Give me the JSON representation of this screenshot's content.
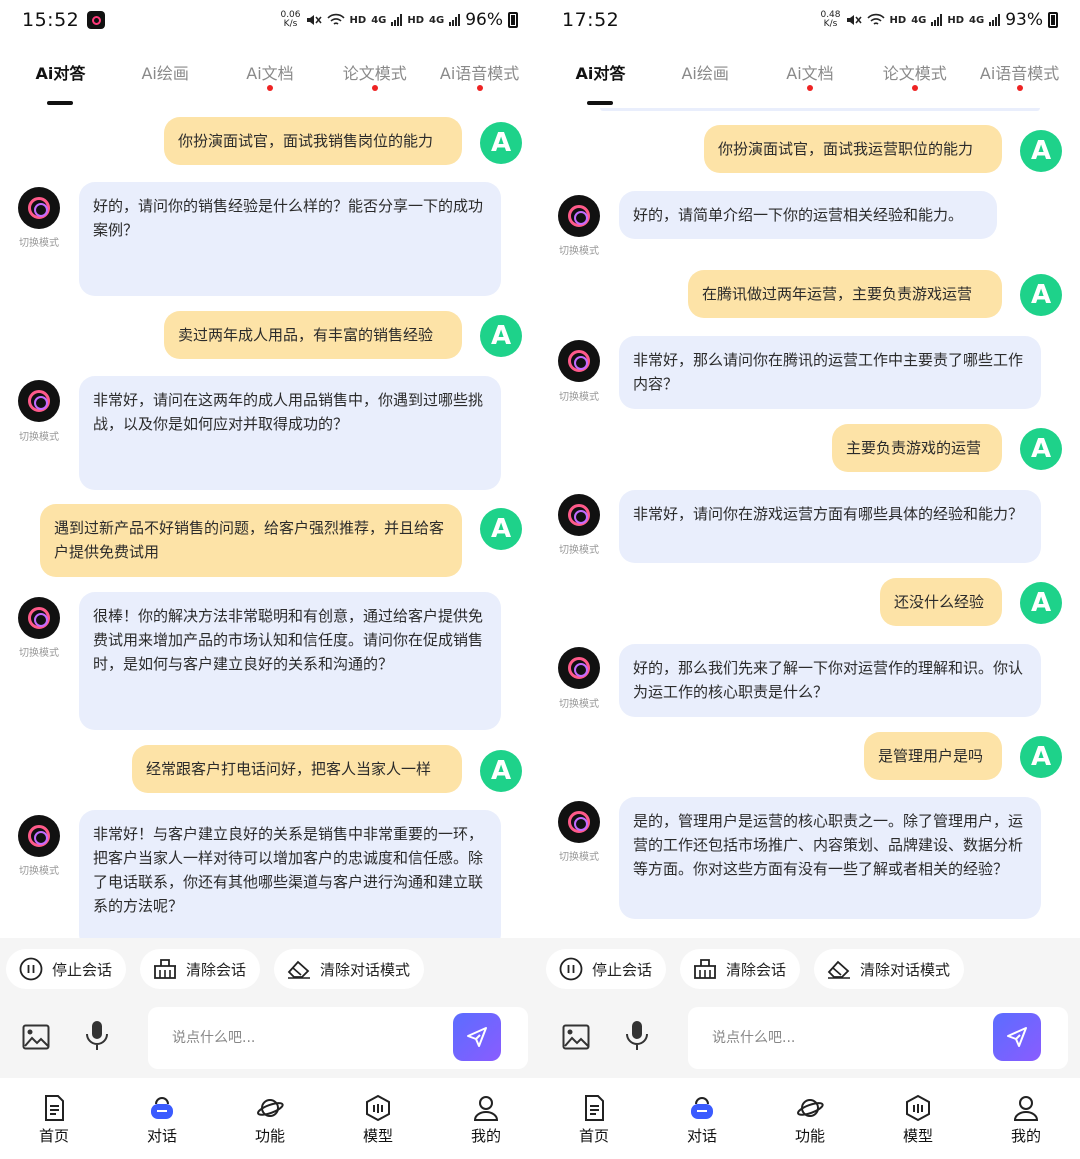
{
  "screens": [
    {
      "status": {
        "time": "15:52",
        "speed_top": "0.06",
        "speed_bottom": "K/s",
        "hd1": "HD",
        "net1": "4G",
        "hd2": "HD",
        "net2": "4G",
        "battery": "96%"
      },
      "tabs": [
        {
          "label": "Ai对答",
          "active": true,
          "dot": false
        },
        {
          "label": "Ai绘画",
          "active": false,
          "dot": false
        },
        {
          "label": "Ai文档",
          "active": false,
          "dot": true
        },
        {
          "label": "论文模式",
          "active": false,
          "dot": true
        },
        {
          "label": "Ai语音模式",
          "active": false,
          "dot": true
        }
      ],
      "messages": [
        {
          "role": "user",
          "text": "你扮演面试官，面试我销售岗位的能力"
        },
        {
          "role": "bot",
          "text": "好的，请问你的销售经验是什么样的？能否分享一下的成功案例？"
        },
        {
          "role": "user",
          "text": "卖过两年成人用品，有丰富的销售经验"
        },
        {
          "role": "bot",
          "text": "非常好，请问在这两年的成人用品销售中，你遇到过哪些挑战，以及你是如何应对并取得成功的？"
        },
        {
          "role": "user",
          "text": "遇到过新产品不好销售的问题，给客户强烈推荐，并且给客户提供免费试用"
        },
        {
          "role": "bot",
          "text": "很棒！你的解决方法非常聪明和有创意，通过给客户提供免费试用来增加产品的市场认知和信任度。请问你在促成销售时，是如何与客户建立良好的关系和沟通的？"
        },
        {
          "role": "user",
          "text": "经常跟客户打电话问好，把客人当家人一样"
        },
        {
          "role": "bot",
          "text": "非常好！与客户建立良好的关系是销售中非常重要的一环，把客户当家人一样对待可以增加客户的忠诚度和信任感。除了电话联系，你还有其他哪些渠道与客户进行沟通和建立联系的方法呢？"
        }
      ],
      "switch_label": "切换模式",
      "actions": {
        "stop": "停止会话",
        "clear": "清除会话",
        "clear_mode": "清除对话模式"
      },
      "input": {
        "placeholder": "说点什么吧...",
        "value": ""
      },
      "nav": [
        "首页",
        "对话",
        "功能",
        "模型",
        "我的"
      ]
    },
    {
      "status": {
        "time": "17:52",
        "speed_top": "0.48",
        "speed_bottom": "K/s",
        "hd1": "HD",
        "net1": "4G",
        "hd2": "HD",
        "net2": "4G",
        "battery": "93%"
      },
      "tabs": [
        {
          "label": "Ai对答",
          "active": true,
          "dot": false
        },
        {
          "label": "Ai绘画",
          "active": false,
          "dot": false
        },
        {
          "label": "Ai文档",
          "active": false,
          "dot": true
        },
        {
          "label": "论文模式",
          "active": false,
          "dot": true
        },
        {
          "label": "Ai语音模式",
          "active": false,
          "dot": true
        }
      ],
      "messages": [
        {
          "role": "user",
          "text": "你扮演面试官，面试我运营职位的能力"
        },
        {
          "role": "bot",
          "text": "好的，请简单介绍一下你的运营相关经验和能力。"
        },
        {
          "role": "user",
          "text": "在腾讯做过两年运营，主要负责游戏运营"
        },
        {
          "role": "bot",
          "text": "非常好，那么请问你在腾讯的运营工作中主要责了哪些工作内容？"
        },
        {
          "role": "user",
          "text": "主要负责游戏的运营"
        },
        {
          "role": "bot",
          "text": "非常好，请问你在游戏运营方面有哪些具体的经验和能力？"
        },
        {
          "role": "user",
          "text": "还没什么经验"
        },
        {
          "role": "bot",
          "text": "好的，那么我们先来了解一下你对运营作的理解和识。你认为运工作的核心职责是什么？"
        },
        {
          "role": "user",
          "text": "是管理用户是吗"
        },
        {
          "role": "bot",
          "text": "是的，管理用户是运营的核心职责之一。除了管理用户，运营的工作还包括市场推广、内容策划、品牌建设、数据分析等方面。你对这些方面有没有一些了解或者相关的经验？"
        }
      ],
      "switch_label": "切换模式",
      "actions": {
        "stop": "停止会话",
        "clear": "清除会话",
        "clear_mode": "清除对话模式"
      },
      "input": {
        "placeholder": "说点什么吧...",
        "value": ""
      },
      "nav": [
        "首页",
        "对话",
        "功能",
        "模型",
        "我的"
      ]
    }
  ],
  "colors": {
    "user_bubble": "#fde3a7",
    "bot_bubble": "#e9eefc",
    "user_avatar": "#1ed28a",
    "tab_dot": "#ee2323",
    "send_button": "#6f63ff"
  }
}
